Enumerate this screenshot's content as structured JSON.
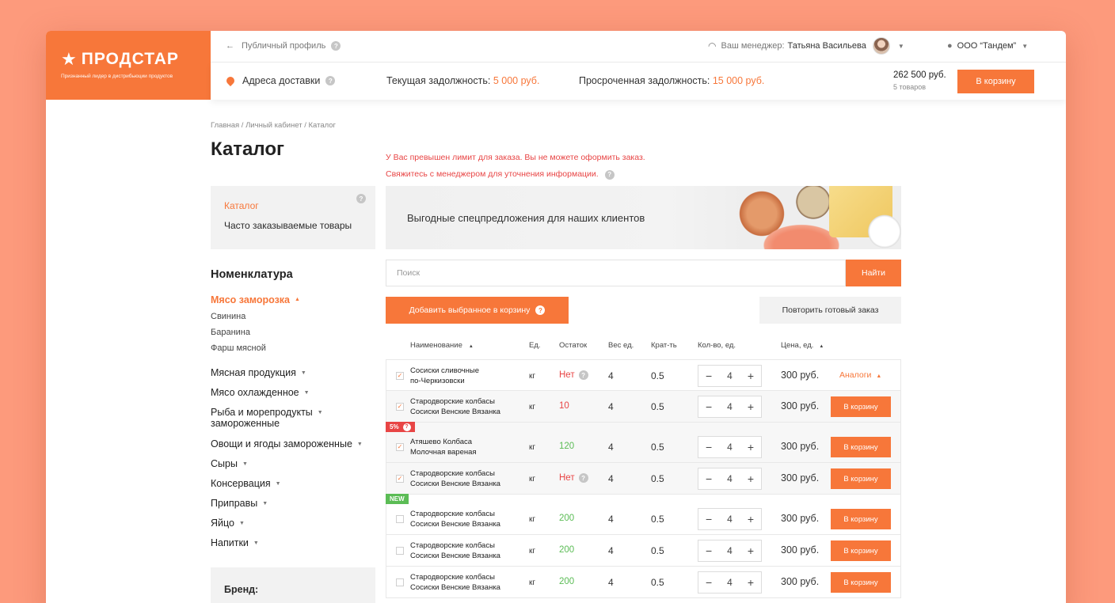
{
  "brand": {
    "name": "ПРОДСТАР",
    "tagline": "Признанный лидер в дистрибьюции продуктов",
    "accent": "#f7773a"
  },
  "topbar": {
    "back_label": "Публичный профиль",
    "manager_label": "Ваш менеджер:",
    "manager_name": "Татьяна Васильева",
    "company": "ООО “Тандем”"
  },
  "secondbar": {
    "delivery": "Адреса доставки",
    "debt_label": "Текущая задолжность:",
    "debt_value": "5 000 руб.",
    "overdue_label": "Просроченная задолжность:",
    "overdue_value": "15 000 руб.",
    "cart_sum": "262 500 руб.",
    "cart_count": "5 товаров",
    "cart_button": "В корзину"
  },
  "breadcrumb": "Главная / Личный кабинет / Каталог",
  "page_title": "Каталог",
  "warning": {
    "line1": "У Вас превышен лимит для заказа. Вы не можете оформить заказ.",
    "line2": "Свяжитесь с менеджером для уточнения информации."
  },
  "side_menu": {
    "item1": "Каталог",
    "item2": "Часто заказываемые товары"
  },
  "nomenclature": {
    "title": "Номенклатура",
    "active": "Мясо заморозка",
    "subs": [
      "Свинина",
      "Баранина",
      "Фарш мясной"
    ],
    "cats": [
      "Мясная продукция",
      "Мясо охлажденное",
      "Рыба и морепродукты",
      "замороженные",
      "Овощи и ягоды замороженные",
      "Сыры",
      "Консервация",
      "Приправы",
      "Яйцо",
      "Напитки"
    ]
  },
  "brand_filter": "Бренд:",
  "banner": "Выгодные спецпредложения для наших клиентов",
  "search": {
    "placeholder": "Поиск",
    "button": "Найти"
  },
  "actions": {
    "add_selected": "Добавить выбранное в корзину",
    "repeat": "Повторить готовый заказ"
  },
  "table": {
    "headers": {
      "name": "Наименование",
      "unit": "Ед.",
      "stock": "Остаток",
      "weight": "Вес ед.",
      "mult": "Крат-ть",
      "qty": "Кол-во, ед.",
      "price": "Цена, ед."
    },
    "rows": [
      {
        "name1": "Сосиски сливочные",
        "name2": "по-Черкизовски",
        "unit": "кг",
        "stock": "Нет",
        "weight": "4",
        "mult": "0.5",
        "qty": "4",
        "price": "300 руб.",
        "action": "Аналоги",
        "checked": "✓"
      },
      {
        "name1": "Стародворские колбасы",
        "name2": "Сосиски Венские Вязанка",
        "unit": "кг",
        "stock": "10",
        "weight": "4",
        "mult": "0.5",
        "qty": "4",
        "price": "300 руб.",
        "action": "В корзину",
        "checked": "✓"
      },
      {
        "name1": "Атяшево Колбаса",
        "name2": "Молочная вареная",
        "unit": "кг",
        "stock": "120",
        "weight": "4",
        "mult": "0.5",
        "qty": "4",
        "price": "300 руб.",
        "action": "В корзину",
        "checked": "✓",
        "tag": "5%"
      },
      {
        "name1": "Стародворские колбасы",
        "name2": "Сосиски Венские Вязанка",
        "unit": "кг",
        "stock": "Нет",
        "weight": "4",
        "mult": "0.5",
        "qty": "4",
        "price": "300 руб.",
        "action": "В корзину",
        "checked": "✓"
      },
      {
        "name1": "Стародворские колбасы",
        "name2": "Сосиски Венские Вязанка",
        "unit": "кг",
        "stock": "200",
        "weight": "4",
        "mult": "0.5",
        "qty": "4",
        "price": "300 руб.",
        "action": "В корзину",
        "checked": "",
        "tag": "NEW"
      },
      {
        "name1": "Стародворские колбасы",
        "name2": "Сосиски Венские Вязанка",
        "unit": "кг",
        "stock": "200",
        "weight": "4",
        "mult": "0.5",
        "qty": "4",
        "price": "300 руб.",
        "action": "В корзину",
        "checked": ""
      },
      {
        "name1": "Стародворские колбасы",
        "name2": "Сосиски Венские Вязанка",
        "unit": "кг",
        "stock": "200",
        "weight": "4",
        "mult": "0.5",
        "qty": "4",
        "price": "300 руб.",
        "action": "В корзину",
        "checked": ""
      }
    ]
  }
}
